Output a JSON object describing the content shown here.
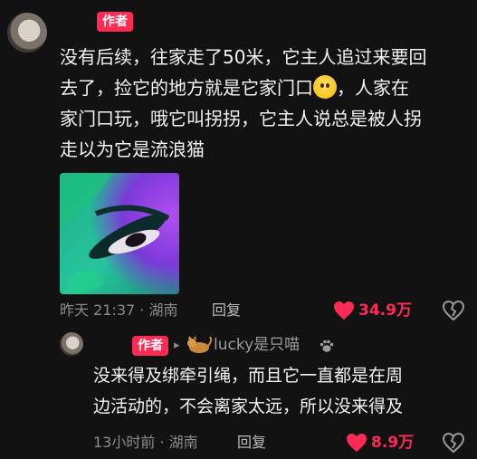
{
  "comment": {
    "author_badge": "作者",
    "text_lines": [
      "没有后续，往家走了50米，它主人追过来要回",
      "去了，捡它的地方就是它家门口",
      "，人家在",
      "家门口玩，哦它叫拐拐，它主人说总是被人拐",
      "走以为它是流浪猫"
    ],
    "meta": "昨天 21:37 · 湖南",
    "reply_label": "回复",
    "likes": "34.9万"
  },
  "reply": {
    "author_badge": "作者",
    "arrow": "▸",
    "target_user": "lucky是只喵",
    "text_lines": [
      "没来得及绑牵引绳，而且它一直都是在周",
      "边活动的，不会离家太远，所以没来得及"
    ],
    "meta": "13小时前 · 湖南",
    "reply_label": "回复",
    "likes": "8.9万"
  },
  "colors": {
    "background": "#121212",
    "accent": "#ff2b55",
    "meta": "#8c8c8c"
  }
}
